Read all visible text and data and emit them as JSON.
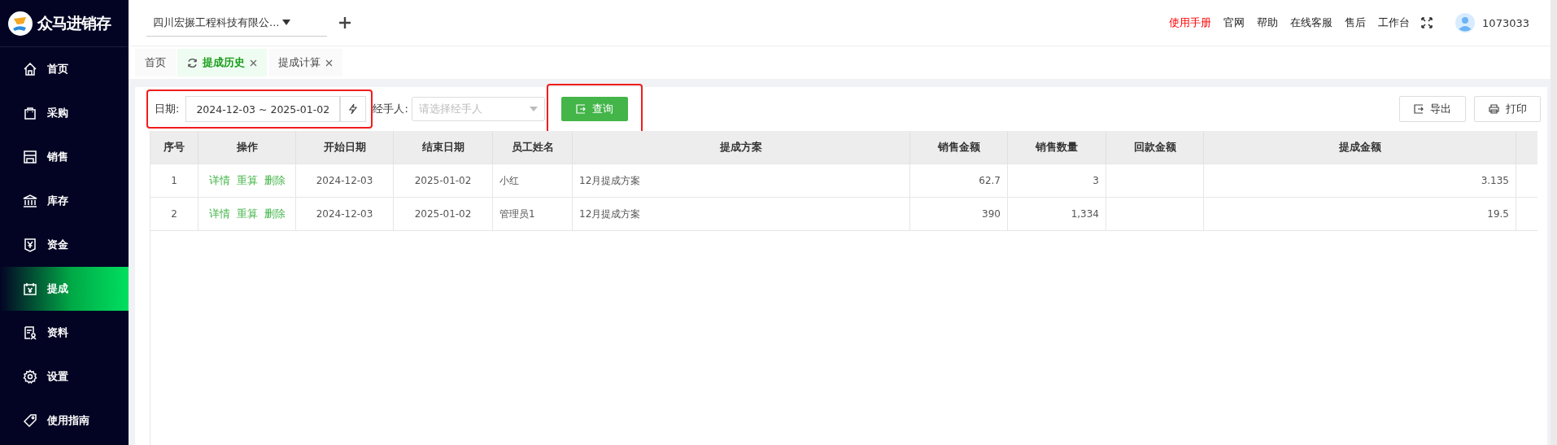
{
  "app": {
    "name": "众马进销存"
  },
  "sidebar": {
    "items": [
      {
        "label": "首页",
        "selected": false
      },
      {
        "label": "采购",
        "selected": false
      },
      {
        "label": "销售",
        "selected": false
      },
      {
        "label": "库存",
        "selected": false
      },
      {
        "label": "资金",
        "selected": false
      },
      {
        "label": "提成",
        "selected": true
      },
      {
        "label": "资料",
        "selected": false
      },
      {
        "label": "设置",
        "selected": false
      },
      {
        "label": "使用指南",
        "selected": false
      }
    ]
  },
  "header": {
    "company": "四川宏搌工程科技有限公...",
    "links": [
      {
        "label": "使用手册",
        "emphasized": true
      },
      {
        "label": "官网",
        "emphasized": false
      },
      {
        "label": "帮助",
        "emphasized": false
      },
      {
        "label": "在线客服",
        "emphasized": false
      },
      {
        "label": "售后",
        "emphasized": false
      },
      {
        "label": "工作台",
        "emphasized": false
      }
    ],
    "user": "1073033"
  },
  "tabs": [
    {
      "label": "首页",
      "selected": false,
      "refresh": false,
      "closable": false
    },
    {
      "label": "提成历史",
      "selected": true,
      "refresh": true,
      "closable": true
    },
    {
      "label": "提成计算",
      "selected": false,
      "refresh": false,
      "closable": true
    }
  ],
  "filters": {
    "date_label": "日期:",
    "date_range": "2024-12-03 ~ 2025-01-02",
    "date_highlighted": true,
    "handler_label": "经手人:",
    "handler_placeholder": "请选择经手人",
    "query_button": "查询",
    "query_highlighted": true
  },
  "actions": [
    "导出",
    "打印"
  ],
  "table": {
    "columns": [
      "序号",
      "操作",
      "开始日期",
      "结束日期",
      "员工姓名",
      "提成方案",
      "销售金额",
      "销售数量",
      "回款金额",
      "提成金额"
    ],
    "rows": [
      {
        "index": "1",
        "actions": [
          "详情",
          "重算",
          "删除"
        ],
        "start": "2024-12-03",
        "end": "2025-01-02",
        "employee": "小红",
        "plan": "12月提成方案",
        "sales_amount": "62.7",
        "sales_qty": "3",
        "returned": "",
        "commission": "3.135"
      },
      {
        "index": "2",
        "actions": [
          "详情",
          "重算",
          "删除"
        ],
        "start": "2024-12-03",
        "end": "2025-01-02",
        "employee": "管理员1",
        "plan": "12月提成方案",
        "sales_amount": "390",
        "sales_qty": "1,334",
        "returned": "",
        "commission": "19.5"
      }
    ]
  }
}
